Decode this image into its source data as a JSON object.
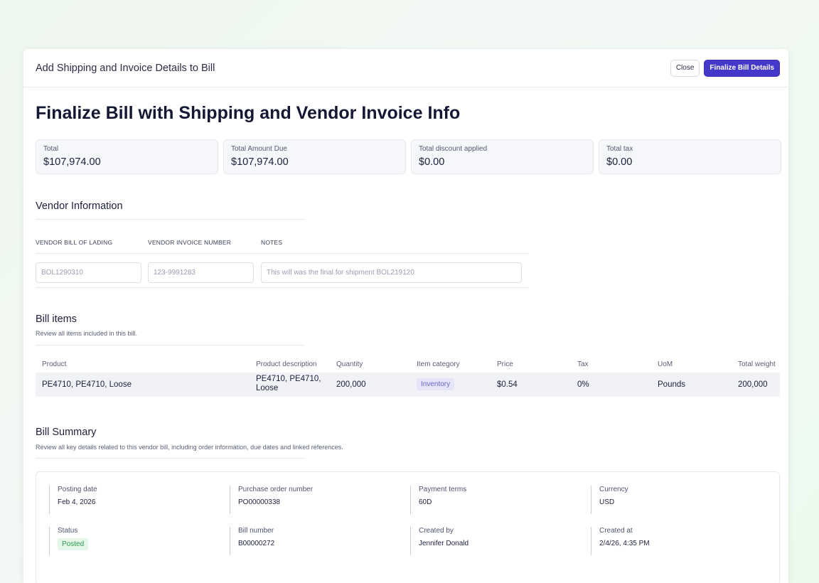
{
  "modal": {
    "title": "Add Shipping and Invoice Details to Bill",
    "close_label": "Close",
    "finalize_label": "Finalize Bill Details"
  },
  "page_title": "Finalize Bill with Shipping and Vendor Invoice Info",
  "stats": [
    {
      "label": "Total",
      "value": "$107,974.00"
    },
    {
      "label": "Total Amount Due",
      "value": "$107,974.00"
    },
    {
      "label": "Total discount applied",
      "value": "$0.00"
    },
    {
      "label": "Total tax",
      "value": "$0.00"
    }
  ],
  "vendor": {
    "title": "Vendor Information",
    "fields": [
      {
        "label": "VENDOR BILL OF LADING",
        "placeholder": "BOL1290310"
      },
      {
        "label": "VENDOR INVOICE NUMBER",
        "placeholder": "123-9991283"
      },
      {
        "label": "NOTES",
        "placeholder": "This will was the final for shipment BOL219120"
      }
    ]
  },
  "bill_items": {
    "title": "Bill items",
    "subtitle": "Review all items included in this bill.",
    "columns": [
      "Product",
      "Product description",
      "Quantity",
      "Item category",
      "Price",
      "Tax",
      "UoM",
      "Total weight"
    ],
    "rows": [
      {
        "product": "PE4710, PE4710, Loose",
        "description_line1": "PE4710, PE4710,",
        "description_line2": "Loose",
        "quantity": "200,000",
        "category": "Inventory",
        "price": "$0.54",
        "tax": "0%",
        "uom": "Pounds",
        "total_weight": "200,000"
      }
    ]
  },
  "summary": {
    "title": "Bill Summary",
    "subtitle": "Review all key details related to this vendor bill, including order information, due dates and linked references.",
    "items": [
      {
        "label": "Posting date",
        "value": "Feb 4, 2026"
      },
      {
        "label": "Purchase order number",
        "value": "PO00000338"
      },
      {
        "label": "Payment terms",
        "value": "60D"
      },
      {
        "label": "Currency",
        "value": "USD"
      },
      {
        "label": "Status",
        "value": "Posted"
      },
      {
        "label": "Bill number",
        "value": "B00000272"
      },
      {
        "label": "Created by",
        "value": "Jennifer Donald"
      },
      {
        "label": "Created at",
        "value": "2/4/26, 4:35 PM"
      }
    ]
  },
  "colors": {
    "primary": "#4338ca",
    "status_posted": "#2f9d54",
    "category_tag": "#6b66c9"
  }
}
